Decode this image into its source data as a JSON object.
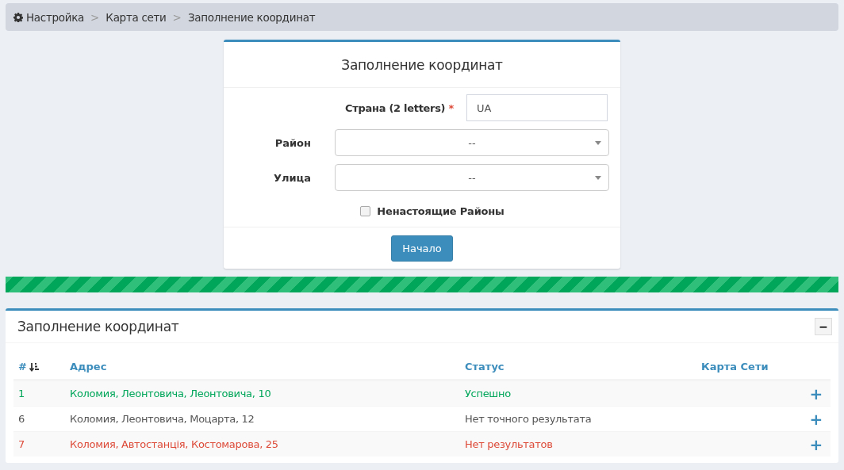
{
  "breadcrumb": [
    {
      "label": "Настройка"
    },
    {
      "label": "Карта сети"
    },
    {
      "label": "Заполнение координат"
    }
  ],
  "breadcrumb_separators": [
    ">",
    ">"
  ],
  "form": {
    "title": "Заполнение координат",
    "country": {
      "label": "Страна",
      "hint": "(2 letters)",
      "required_mark": "*",
      "value": "UA"
    },
    "district": {
      "label": "Район",
      "value": "--"
    },
    "street": {
      "label": "Улица",
      "value": "--"
    },
    "fake_districts": {
      "label": "Ненастоящие Районы",
      "checked": false
    },
    "submit": "Начало"
  },
  "progress": {
    "level": 1
  },
  "results": {
    "title": "Заполнение координат",
    "collapse": "−",
    "columns": [
      "#",
      "Адрес",
      "Статус",
      "Карта Сети"
    ],
    "rows": [
      {
        "num": "1",
        "address": "Коломия, Леонтовича, Леонтовича, 10",
        "status": "Успешно",
        "color": "#00a65a",
        "action": "+"
      },
      {
        "num": "6",
        "address": "Коломия, Леонтовича, Моцарта, 12",
        "status": "Нет точного результата",
        "color": "#555555",
        "action": "+"
      },
      {
        "num": "7",
        "address": "Коломия, Автостанція, Костомарова, 25",
        "status": "Нет результатов",
        "color": "#dd4b39",
        "action": "+"
      }
    ]
  }
}
